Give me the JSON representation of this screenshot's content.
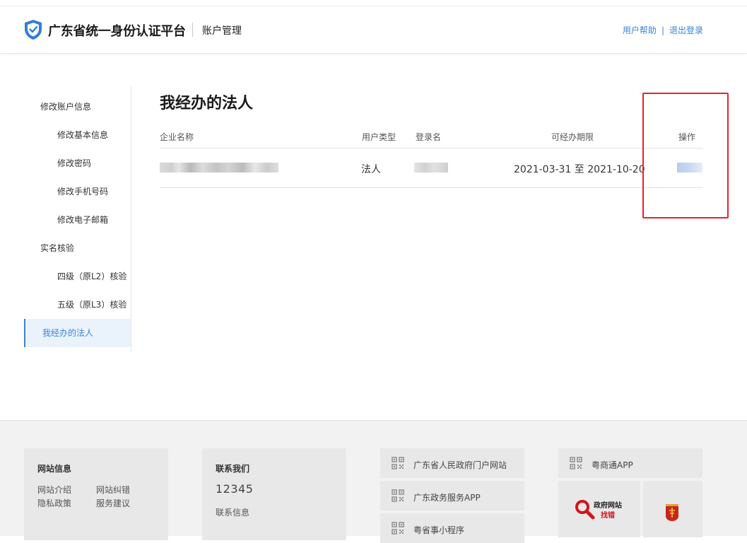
{
  "header": {
    "brand": "广东省统一身份认证平台",
    "subtitle": "账户管理",
    "help": "用户帮助",
    "divider": "|",
    "logout": "退出登录"
  },
  "sidebar": {
    "items": [
      {
        "label": "修改账户信息",
        "type": "group"
      },
      {
        "label": "修改基本信息",
        "type": "child"
      },
      {
        "label": "修改密码",
        "type": "child"
      },
      {
        "label": "修改手机号码",
        "type": "child"
      },
      {
        "label": "修改电子邮箱",
        "type": "child"
      },
      {
        "label": "实名核验",
        "type": "group"
      },
      {
        "label": "四级（原L2）核验",
        "type": "child"
      },
      {
        "label": "五级（原L3）核验",
        "type": "child"
      },
      {
        "label": "我经办的法人",
        "type": "active"
      }
    ]
  },
  "main": {
    "title": "我经办的法人",
    "columns": [
      "企业名称",
      "用户类型",
      "登录名",
      "可经办期限",
      "操作"
    ],
    "rows": [
      {
        "company": "",
        "user_type": "法人",
        "login": "",
        "period": "2021-03-31 至 2021-10-20",
        "operation": ""
      }
    ]
  },
  "footer": {
    "site_info": {
      "title": "网站信息",
      "links": [
        "网站介绍",
        "网站纠错",
        "隐私政策",
        "服务建议"
      ]
    },
    "contact": {
      "title": "联系我们",
      "phone": "12345",
      "link": "联系信息"
    },
    "links_col1": [
      "广东省人民政府门户网站",
      "广东政务服务APP",
      "粤省事小程序"
    ],
    "links_col2": [
      "粤商通APP"
    ],
    "badge_text": {
      "line1": "政府网站",
      "line2": "找错"
    }
  },
  "colors": {
    "accent": "#3a84d6",
    "highlight": "#e8222c",
    "active_bg": "#eaf3fc"
  }
}
